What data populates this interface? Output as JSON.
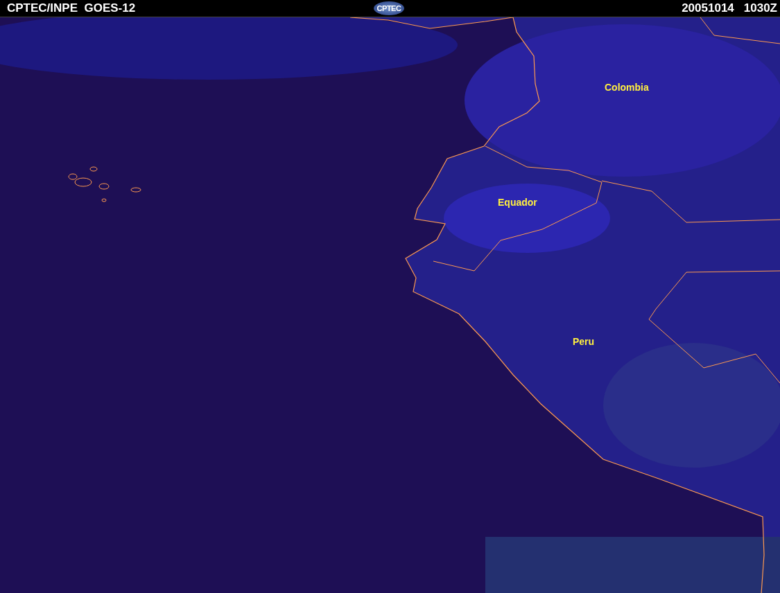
{
  "header": {
    "title": "CPTEC/INPE  GOES-12",
    "logo": "CPTEC",
    "date": "20051014",
    "time": "1030Z"
  },
  "map": {
    "labels": [
      {
        "text": "Colombia"
      },
      {
        "text": "Equador"
      },
      {
        "text": "Peru"
      }
    ]
  }
}
